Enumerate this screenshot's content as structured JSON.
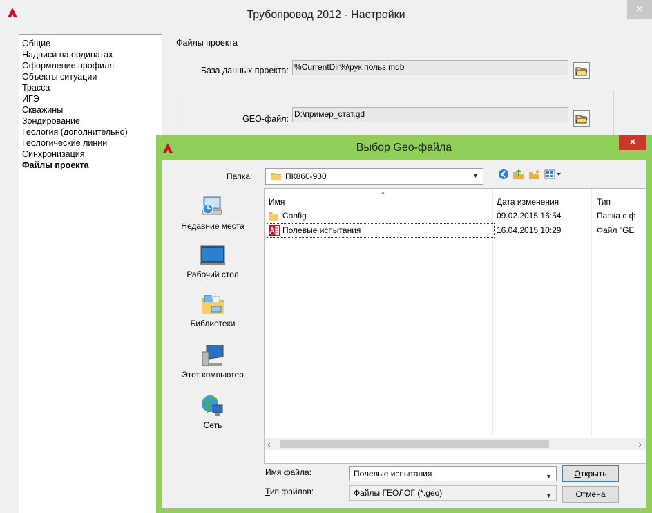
{
  "main_window": {
    "title": "Трубопровод 2012 - Настройки",
    "close_label": "×",
    "nav_items": [
      "Общие",
      "Надписи на ординатах",
      "Оформление профиля",
      "Объекты ситуации",
      "Трасса",
      "ИГЭ",
      "Скважины",
      "Зондирование",
      "Геология (дополнительно)",
      "Геологические линии",
      "Синхронизация",
      "Файлы проекта"
    ],
    "active_nav": "Файлы проекта",
    "group_title": "Файлы проекта",
    "db_label": "База данных проекта:",
    "db_value": "%CurrentDir%\\рук.польз.mdb",
    "geo_label": "GEO-файл:",
    "geo_value": "D:\\пример_стат.gd"
  },
  "dialog": {
    "title": "Выбор Geo-файла",
    "close_label": "×",
    "folder_label_pre": "Пап",
    "folder_label_u": "к",
    "folder_label_post": "а:",
    "folder_value": "ПК860-930",
    "places": [
      {
        "label": "Недавние места",
        "icon": "recent-places-icon"
      },
      {
        "label": "Рабочий стол",
        "icon": "desktop-icon"
      },
      {
        "label": "Библиотеки",
        "icon": "libraries-icon"
      },
      {
        "label": "Этот компьютер",
        "icon": "computer-icon"
      },
      {
        "label": "Сеть",
        "icon": "network-icon"
      }
    ],
    "columns": [
      "Имя",
      "Дата изменения",
      "Тип"
    ],
    "files": [
      {
        "name": "Config",
        "date": "09.02.2015 16:54",
        "type": "Папка с ф",
        "icon": "folder-icon"
      },
      {
        "name": "Полевые испытания",
        "date": "16.04.2015 10:29",
        "type": "Файл \"GE",
        "icon": "geo-file-icon"
      }
    ],
    "filename_label_u": "И",
    "filename_label_post": "мя файла:",
    "filename_value": "Полевые испытания",
    "filetype_label_u": "Т",
    "filetype_label_post": "ип файлов:",
    "filetype_value": "Файлы ГЕОЛОГ (*.geo)",
    "open_label_u": "О",
    "open_label_post": "ткрыть",
    "cancel_label": "Отмена"
  },
  "colors": {
    "dialog_border": "#90d05a",
    "close_red": "#c7372a",
    "autocad_red": "#c8102e"
  }
}
